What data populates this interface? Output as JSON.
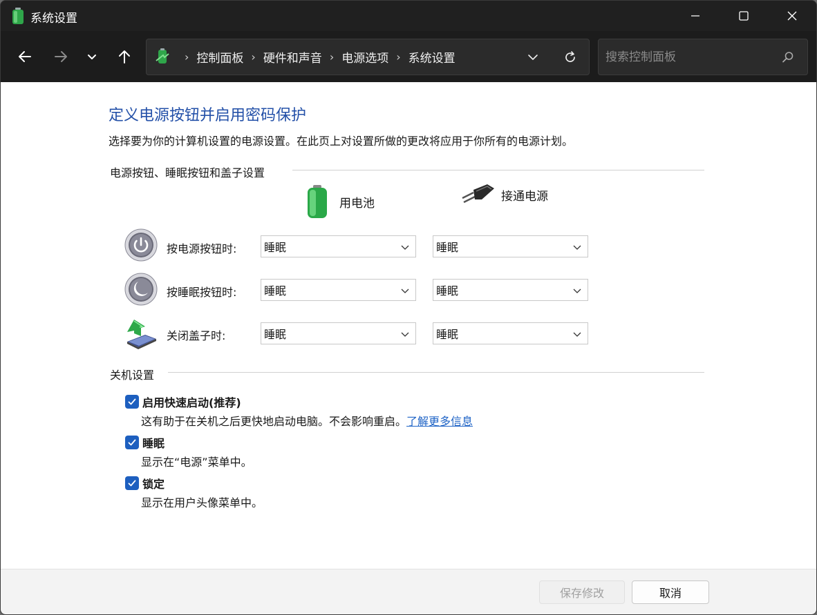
{
  "window": {
    "title": "系统设置",
    "app_icon": "battery-icon"
  },
  "nav": {
    "breadcrumb": [
      "控制面板",
      "硬件和声音",
      "电源选项",
      "系统设置"
    ],
    "search_placeholder": "搜索控制面板"
  },
  "main": {
    "title": "定义电源按钮并启用密码保护",
    "description": "选择要为你的计算机设置的电源设置。在此页上对设置所做的更改将应用于你所有的电源计划。",
    "power_group": {
      "heading": "电源按钮、睡眠按钮和盖子设置",
      "col_battery": "用电池",
      "col_plugged": "接通电源",
      "rows": [
        {
          "label": "按电源按钮时:",
          "icon": "power-button-icon",
          "battery": "睡眠",
          "plugged": "睡眠"
        },
        {
          "label": "按睡眠按钮时:",
          "icon": "sleep-button-icon",
          "battery": "睡眠",
          "plugged": "睡眠"
        },
        {
          "label": "关闭盖子时:",
          "icon": "laptop-lid-icon",
          "battery": "睡眠",
          "plugged": "睡眠"
        }
      ]
    },
    "shutdown_group": {
      "heading": "关机设置",
      "options": [
        {
          "label": "启用快速启动(推荐)",
          "checked": true,
          "desc": "这有助于在关机之后更快地启动电脑。不会影响重启。",
          "link": "了解更多信息"
        },
        {
          "label": "睡眠",
          "checked": true,
          "desc": "显示在“电源”菜单中。"
        },
        {
          "label": "锁定",
          "checked": true,
          "desc": "显示在用户头像菜单中。"
        }
      ]
    }
  },
  "footer": {
    "save_label": "保存修改",
    "cancel_label": "取消"
  },
  "colors": {
    "title_blue": "#2350a8",
    "checkbox_blue": "#1d5fbf",
    "link_blue": "#1e63c6"
  }
}
